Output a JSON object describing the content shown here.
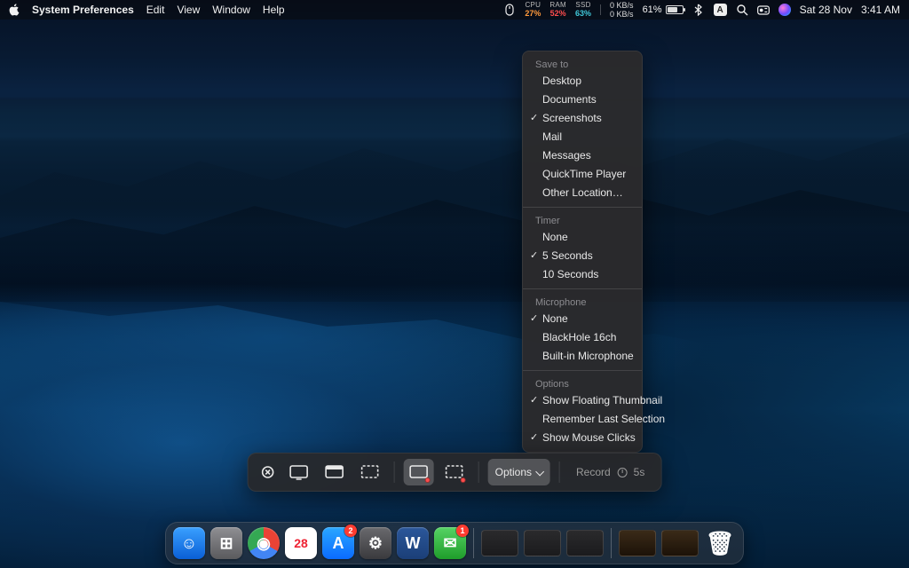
{
  "menubar": {
    "app_name": "System Preferences",
    "items": [
      "Edit",
      "View",
      "Window",
      "Help"
    ],
    "stats": {
      "cpu": {
        "label": "CPU",
        "value": "27%"
      },
      "ram": {
        "label": "RAM",
        "value": "52%"
      },
      "ssd": {
        "label": "SSD",
        "value": "63%"
      }
    },
    "net_up": "0 KB/s",
    "net_down": "0 KB/s",
    "battery_pct": "61%",
    "battery_fill": 61,
    "lang": "A",
    "date": "Sat 28 Nov",
    "time": "3:41 AM"
  },
  "shotbar": {
    "options_label": "Options",
    "record_label": "Record",
    "record_delay": "5s"
  },
  "popover": {
    "sections": [
      {
        "title": "Save to",
        "items": [
          {
            "label": "Desktop",
            "checked": false
          },
          {
            "label": "Documents",
            "checked": false
          },
          {
            "label": "Screenshots",
            "checked": true
          },
          {
            "label": "Mail",
            "checked": false
          },
          {
            "label": "Messages",
            "checked": false
          },
          {
            "label": "QuickTime Player",
            "checked": false
          },
          {
            "label": "Other Location…",
            "checked": false
          }
        ]
      },
      {
        "title": "Timer",
        "items": [
          {
            "label": "None",
            "checked": false
          },
          {
            "label": "5 Seconds",
            "checked": true
          },
          {
            "label": "10 Seconds",
            "checked": false
          }
        ]
      },
      {
        "title": "Microphone",
        "items": [
          {
            "label": "None",
            "checked": true
          },
          {
            "label": "BlackHole 16ch",
            "checked": false
          },
          {
            "label": "Built-in Microphone",
            "checked": false
          }
        ]
      },
      {
        "title": "Options",
        "items": [
          {
            "label": "Show Floating Thumbnail",
            "checked": true
          },
          {
            "label": "Remember Last Selection",
            "checked": false
          },
          {
            "label": "Show Mouse Clicks",
            "checked": true
          }
        ]
      }
    ]
  },
  "dock": {
    "apps": [
      {
        "name": "finder",
        "bg": "linear-gradient(#3aa0ff,#0a5fd6)",
        "glyph": "☺",
        "badge": null
      },
      {
        "name": "launchpad",
        "bg": "linear-gradient(#8f8f93,#5a5a5d)",
        "glyph": "⊞",
        "badge": null
      },
      {
        "name": "chrome",
        "bg": "#fff",
        "glyph": "◉",
        "badge": null
      },
      {
        "name": "calendar",
        "bg": "#fff",
        "glyph": "28",
        "badge": null,
        "glyphColor": "#e23"
      },
      {
        "name": "appstore",
        "bg": "linear-gradient(#2aa7ff,#0a6bff)",
        "glyph": "A",
        "badge": "2"
      },
      {
        "name": "settings",
        "bg": "linear-gradient(#6a6a6e,#3a3a3d)",
        "glyph": "⚙",
        "badge": null
      },
      {
        "name": "word",
        "bg": "linear-gradient(#2b579a,#1b3f78)",
        "glyph": "W",
        "badge": null
      },
      {
        "name": "messages",
        "bg": "linear-gradient(#56d364,#1f9d2b)",
        "glyph": "✉",
        "badge": "1"
      }
    ],
    "trash_glyph": "🗑"
  }
}
